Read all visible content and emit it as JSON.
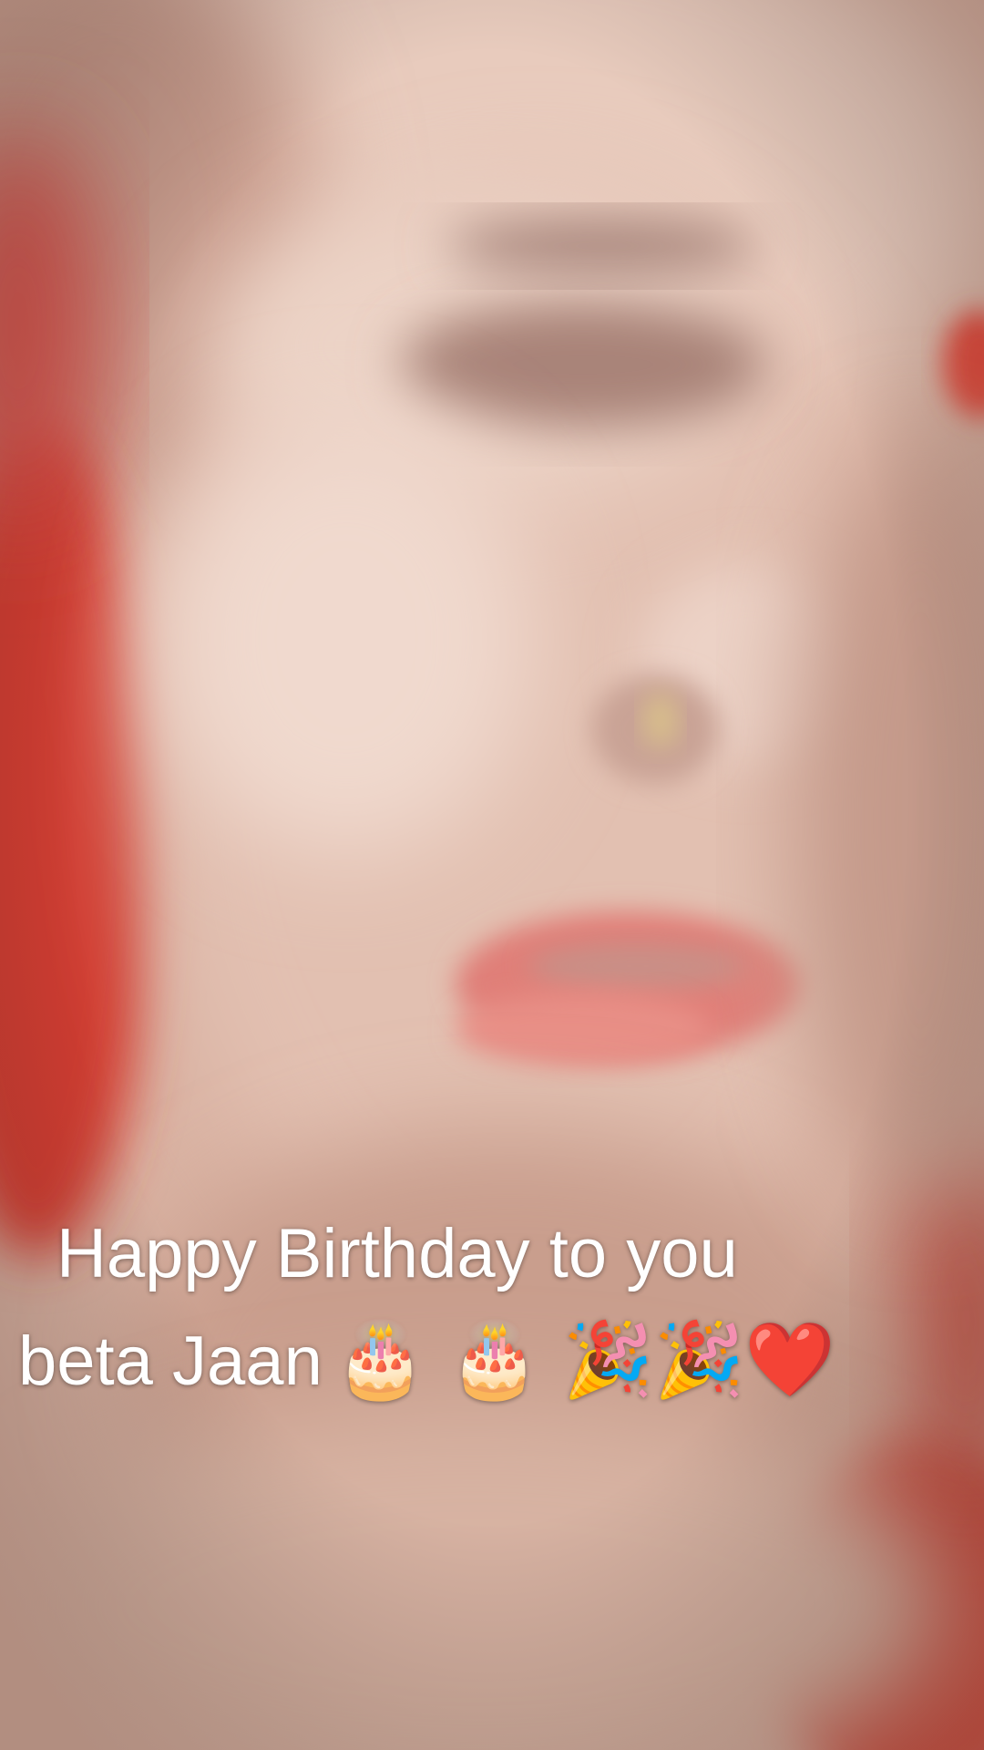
{
  "caption": {
    "line1": "Happy Birthday to you",
    "line2_text": "beta Jaan",
    "line2_emojis": "🎂 🎂 🎉🎉❤️"
  },
  "scene": {
    "skin_color": "#dcb8a8",
    "highlight_color": "#f0d8cc",
    "lip_color": "#e07f78",
    "red_accent_color": "#d8413a",
    "shadow_color": "#b98c7c"
  }
}
